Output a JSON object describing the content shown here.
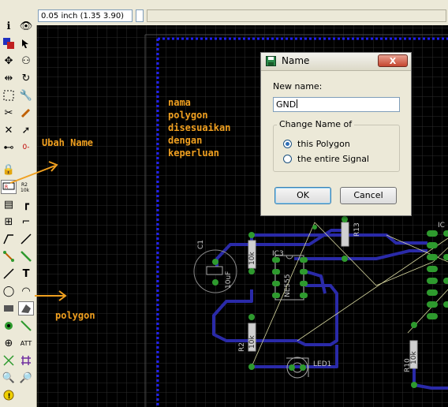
{
  "coordinate_display": "0.05 inch (1.35 3.90)",
  "toolbar": {
    "tools": [
      "info",
      "show",
      "display",
      "mark",
      "move",
      "copy",
      "mirror",
      "group",
      "rotate",
      "change",
      "cut",
      "paste",
      "delete",
      "add",
      "name",
      "value",
      "split",
      "smash",
      "lock",
      "optimize",
      "route",
      "ripup",
      "wire",
      "text",
      "circle",
      "arc",
      "rect",
      "polygon",
      "via",
      "signal",
      "hole",
      "attribute",
      "ratsnest",
      "auto",
      "drc",
      "errors",
      "erc"
    ]
  },
  "annotations": {
    "ubah_name": "Ubah Name",
    "polygon": "polygon",
    "nama_lines": [
      "nama",
      "polygon",
      "disesuaikan",
      "dengan",
      "keperluan"
    ]
  },
  "board": {
    "labels": {
      "c1": "C1",
      "c1_val": "10uF",
      "ic3": "IC3",
      "ic3_val": "NE555",
      "r1": "R1",
      "r1_val": "10k",
      "r2": "R2",
      "r2_val": "10k",
      "r10": "R10",
      "r10_val": "10k",
      "r13": "R13",
      "led1": "LED1",
      "ic_right": "IC"
    }
  },
  "dialog": {
    "title": "Name",
    "new_name_label": "New name:",
    "new_name_value": "GND",
    "group_title": "Change Name of",
    "option_polygon": "this Polygon",
    "option_signal": "the entire Signal",
    "selected_option": "this Polygon",
    "ok_label": "OK",
    "cancel_label": "Cancel",
    "close_label": "X"
  },
  "colors": {
    "annotation": "#f0a020",
    "board_outline": "#2020ff",
    "trace": "#3030c0",
    "pad": "#2e9a2e",
    "grid": "#333333"
  }
}
